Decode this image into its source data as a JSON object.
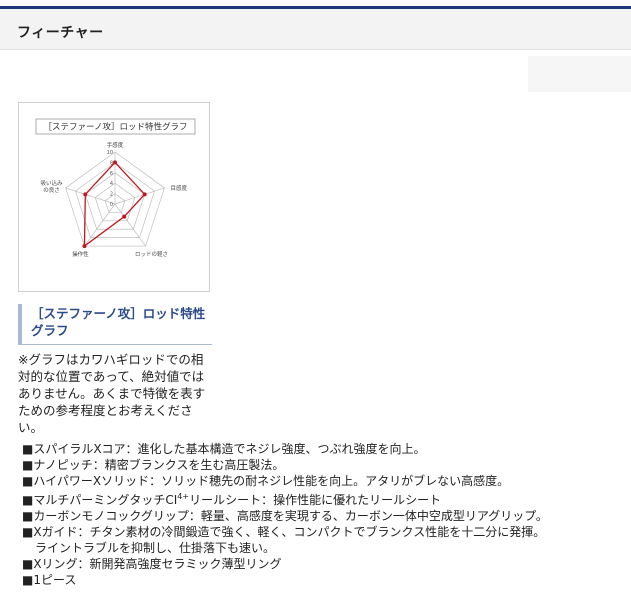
{
  "section": {
    "title": "フィーチャー"
  },
  "radar": {
    "title": "［ステファーノ攻］ロッド特性グラフ",
    "axes": [
      "手感度",
      "目感度",
      "ロッドの軽さ",
      "操作性",
      "吸い込み の良さ"
    ],
    "scale_ticks": [
      "10",
      "8",
      "6",
      "4",
      "2",
      "0"
    ],
    "colors": {
      "line": "#c0161f",
      "web": "#bdbdbd"
    }
  },
  "chart_data": {
    "type": "radar",
    "title": "［ステファーノ攻］ロッド特性グラフ",
    "categories": [
      "手感度",
      "目感度",
      "ロッドの軽さ",
      "操作性",
      "吸い込みの良さ"
    ],
    "rlim": [
      0,
      10
    ],
    "ticks": [
      0,
      2,
      4,
      6,
      8,
      10
    ],
    "series": [
      {
        "values": [
          8,
          6,
          3,
          10,
          6
        ]
      }
    ],
    "grid": true
  },
  "caption": {
    "text": "［ステファーノ攻］ロッド特性グラフ"
  },
  "note": {
    "text": "※グラフはカワハギロッドでの相対的な位置であって、絶対値ではありません。あくまで特徴を表すための参考程度とお考えください。"
  },
  "features": {
    "f1": "■スパイラルXコア：進化した基本構造でネジレ強度、つぶれ強度を向上。",
    "f2": "■ナノピッチ：精密ブランクスを生む高圧製法。",
    "f3": "■ハイパワーXソリッド：ソリッド穂先の耐ネジレ性能を向上。アタリがブレない高感度。",
    "f4_pre": "■マルチパーミングタッチCI",
    "f4_sup": "4+",
    "f4_post": "リールシート：操作性能に優れたリールシート",
    "f5": "■カーボンモノコックグリップ：軽量、高感度を実現する、カーボン一体中空成型リアグリップ。",
    "f6": "■Xガイド：チタン素材の冷間鍛造で強く、軽く、コンパクトでブランクス性能を十二分に発揮。",
    "f6b": "ライントラブルを抑制し、仕掛落下も速い。",
    "f7": "■Xリング：新開発高強度セラミック薄型リング",
    "f8": "■1ピース"
  }
}
